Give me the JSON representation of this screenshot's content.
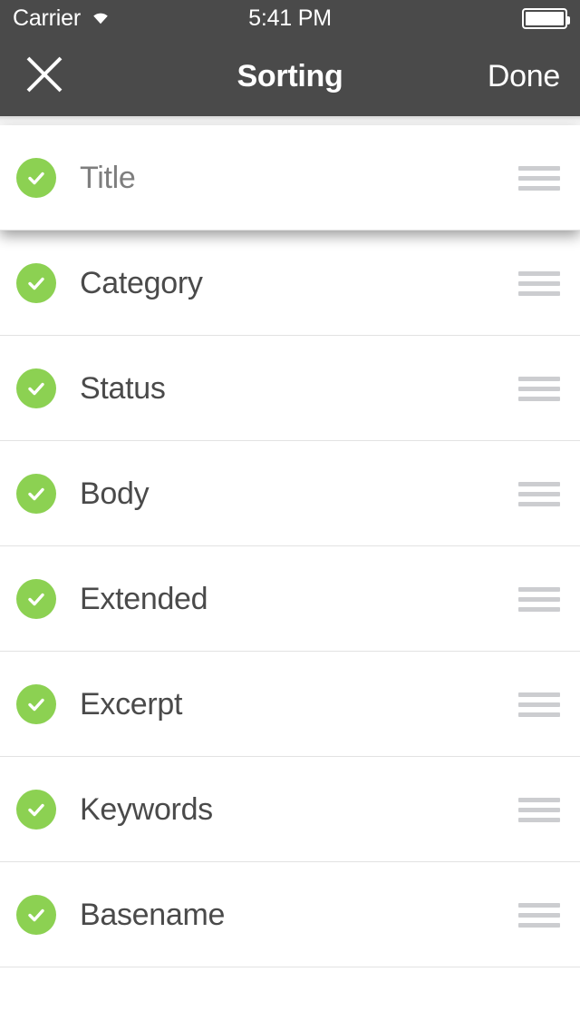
{
  "status_bar": {
    "carrier": "Carrier",
    "wifi_icon": "wifi-icon",
    "time": "5:41 PM",
    "battery_icon": "battery-full-icon"
  },
  "nav_bar": {
    "close_icon": "close-x-icon",
    "title": "Sorting",
    "done_label": "Done"
  },
  "colors": {
    "bar_background": "#4a4a4a",
    "accent_green": "#8cd152",
    "label_text": "#4a4a4a",
    "dragging_label_text": "#7e7e7e",
    "separator": "#e2e2e2",
    "handle_gray": "#cccdd0"
  },
  "list": {
    "rows": [
      {
        "label": "Title",
        "checked": true,
        "dragging": true
      },
      {
        "label": "Category",
        "checked": true,
        "dragging": false
      },
      {
        "label": "Status",
        "checked": true,
        "dragging": false
      },
      {
        "label": "Body",
        "checked": true,
        "dragging": false
      },
      {
        "label": "Extended",
        "checked": true,
        "dragging": false
      },
      {
        "label": "Excerpt",
        "checked": true,
        "dragging": false
      },
      {
        "label": "Keywords",
        "checked": true,
        "dragging": false
      },
      {
        "label": "Basename",
        "checked": true,
        "dragging": false
      }
    ]
  }
}
